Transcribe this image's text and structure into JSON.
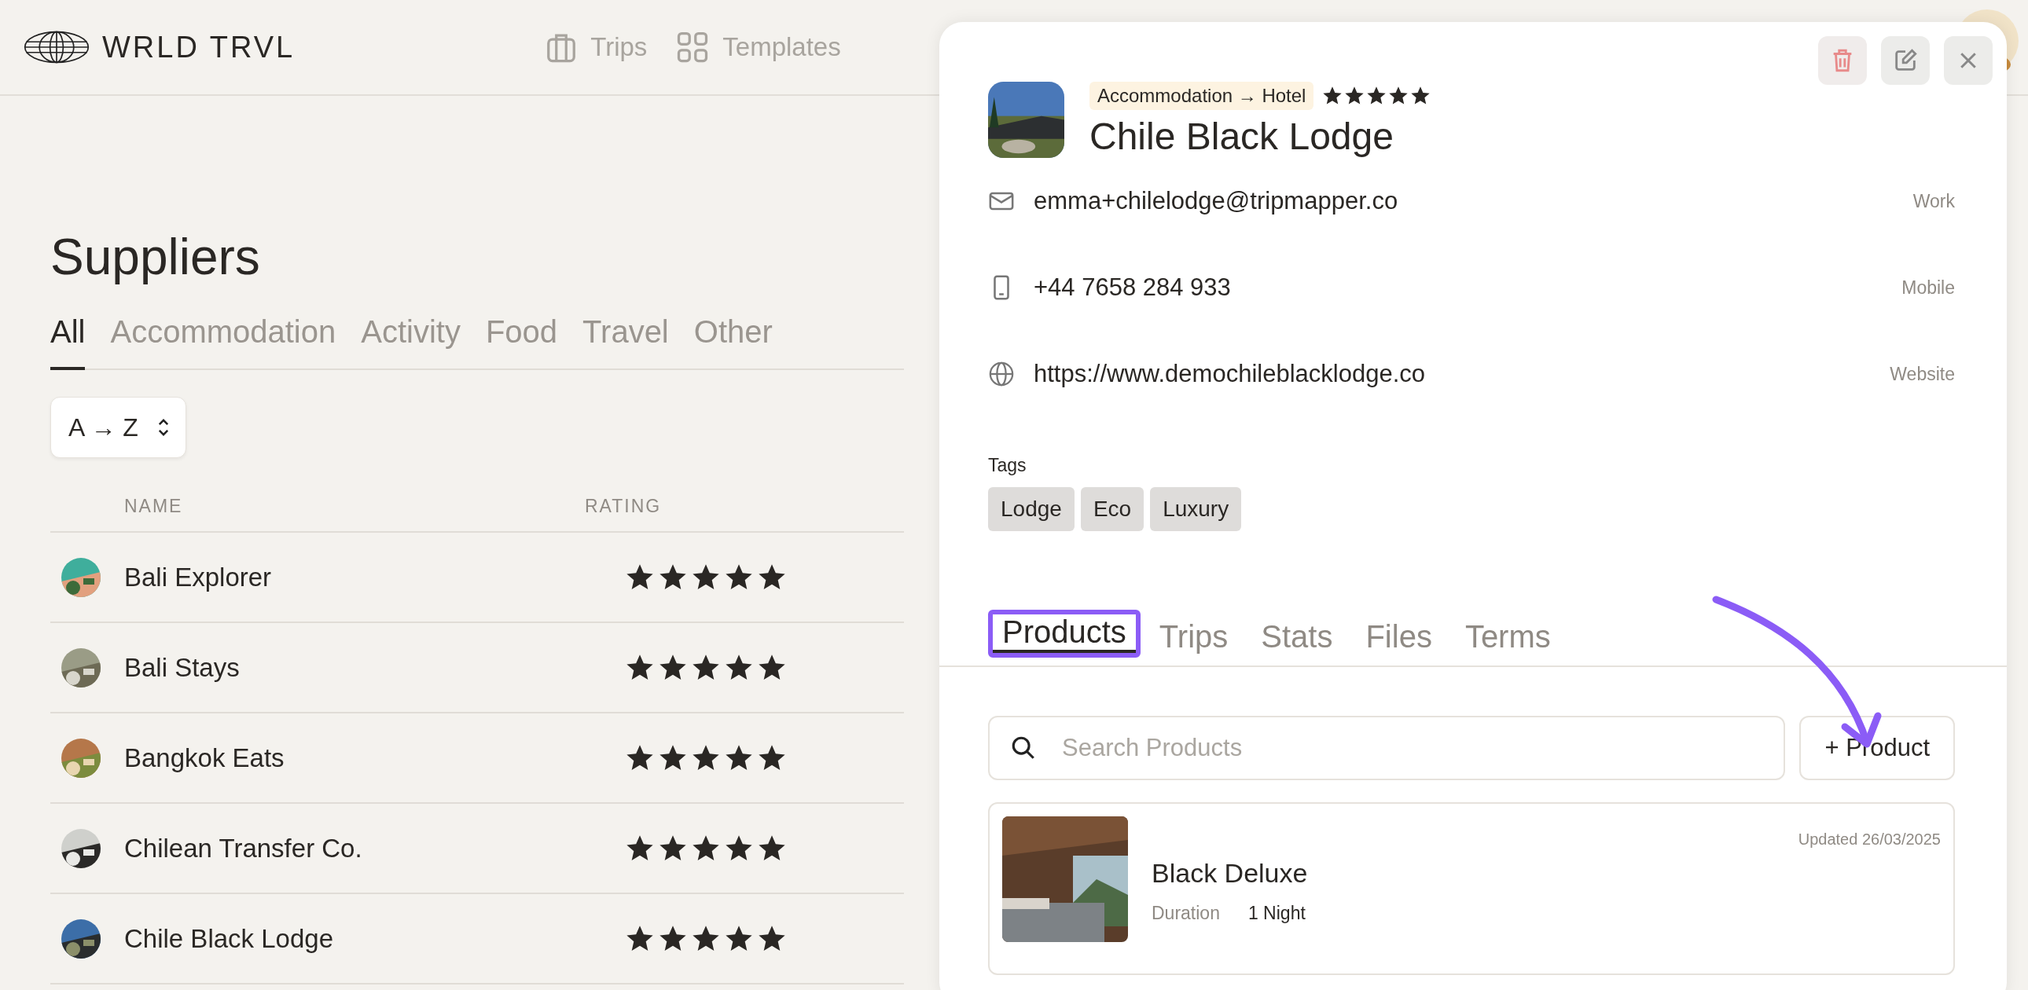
{
  "header": {
    "logo": "WRLD TRVL",
    "nav": [
      {
        "label": "Trips",
        "kind": "trips"
      },
      {
        "label": "Templates",
        "kind": "templates"
      }
    ]
  },
  "page": {
    "title": "Suppliers",
    "tabs": [
      {
        "label": "All",
        "selected": true
      },
      {
        "label": "Accommodation",
        "selected": false
      },
      {
        "label": "Activity",
        "selected": false
      },
      {
        "label": "Food",
        "selected": false
      },
      {
        "label": "Travel",
        "selected": false
      },
      {
        "label": "Other",
        "selected": false
      }
    ],
    "sort": "A → Z",
    "columns": [
      "NAME",
      "RATING"
    ],
    "rows": [
      {
        "name": "Bali Explorer",
        "stars": 5
      },
      {
        "name": "Bali Stays",
        "stars": 5
      },
      {
        "name": "Bangkok Eats",
        "stars": 5
      },
      {
        "name": "Chilean Transfer Co.",
        "stars": 5
      },
      {
        "name": "Chile Black Lodge",
        "stars": 5
      }
    ]
  },
  "panel": {
    "category": "Accommodation → Hotel",
    "stars": 5,
    "title": "Chile Black Lodge",
    "contacts": [
      {
        "kind": "email",
        "value": "emma+chilelodge@tripmapper.co",
        "label": "Work"
      },
      {
        "kind": "phone",
        "value": "+44 7658 284 933",
        "label": "Mobile"
      },
      {
        "kind": "web",
        "value": "https://www.demochileblacklodge.co",
        "label": "Website"
      }
    ],
    "tags_label": "Tags",
    "tags": [
      "Lodge",
      "Eco",
      "Luxury"
    ],
    "tabs": [
      {
        "label": "Products",
        "selected": true,
        "highlighted": true
      },
      {
        "label": "Trips",
        "selected": false,
        "highlighted": false
      },
      {
        "label": "Stats",
        "selected": false,
        "highlighted": false
      },
      {
        "label": "Files",
        "selected": false,
        "highlighted": false
      },
      {
        "label": "Terms",
        "selected": false,
        "highlighted": false
      }
    ],
    "search": {
      "placeholder": "Search Products"
    },
    "add_button": "+ Product",
    "products": [
      {
        "updated": "Updated 26/03/2025",
        "name": "Black Deluxe",
        "duration_label": "Duration",
        "duration": "1 Night"
      }
    ]
  }
}
